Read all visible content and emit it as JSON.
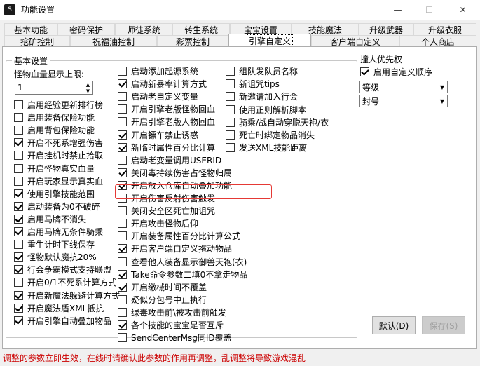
{
  "window": {
    "icon_text": "S",
    "title": "功能设置",
    "minimize": "—",
    "maximize": "☐",
    "close": "✕"
  },
  "tabs_row1": [
    "基本功能",
    "密码保护",
    "师徒系统",
    "转生系统",
    "宝宝设置",
    "技能魔法",
    "升级武器",
    "升级衣服"
  ],
  "tabs_row2": [
    "挖矿控制",
    "祝福油控制",
    "彩票控制",
    "引擎自定义",
    "客户端自定义",
    "个人商店"
  ],
  "active_tab": "引擎自定义",
  "basic_group": {
    "title": "基本设置",
    "hp_label": "怪物血量显示上限:",
    "hp_value": "1"
  },
  "col1": [
    {
      "label": "启用经验更新排行榜",
      "checked": false
    },
    {
      "label": "启用装备保险功能",
      "checked": false
    },
    {
      "label": "启用背包保险功能",
      "checked": false
    },
    {
      "label": "开启不死系增强伤害",
      "checked": true
    },
    {
      "label": "开启挂机时禁止拾取",
      "checked": false
    },
    {
      "label": "开启怪物真实血量",
      "checked": false
    },
    {
      "label": "开启玩家显示真实血",
      "checked": false
    },
    {
      "label": "使用引擎技能范围",
      "checked": true
    },
    {
      "label": "启动装备为0不破碎",
      "checked": true
    },
    {
      "label": "启用马牌不消失",
      "checked": true
    },
    {
      "label": "启用马牌无条件骑乘",
      "checked": true
    },
    {
      "label": "重生计时下线保存",
      "checked": false
    },
    {
      "label": "怪物默认魔抗20%",
      "checked": true
    },
    {
      "label": "行会争霸模式支持联盟",
      "checked": true
    },
    {
      "label": "开启0/1不死系计算方式",
      "checked": false
    },
    {
      "label": "开启新魔法躲避计算方式",
      "checked": true
    },
    {
      "label": "开启魔法盾XML抵抗",
      "checked": true
    },
    {
      "label": "开启引擎自动叠加物品",
      "checked": true
    }
  ],
  "col2": [
    {
      "label": "启动添加起源系统",
      "checked": false
    },
    {
      "label": "启动新暴率计算方式",
      "checked": true
    },
    {
      "label": "启动老自定义变量",
      "checked": false
    },
    {
      "label": "开启引擎老版怪物回血",
      "checked": false
    },
    {
      "label": "开启引擎老版人物回血",
      "checked": false
    },
    {
      "label": "开启镖车禁止诱惑",
      "checked": true
    },
    {
      "label": "新临时属性百分比计算",
      "checked": true
    },
    {
      "label": "启动老变量调用USERID",
      "checked": false
    },
    {
      "label": "关闭毒持续伤害占怪物归属",
      "checked": true
    },
    {
      "label": "开启放入仓库自动叠加功能",
      "checked": true
    },
    {
      "label": "开启伤害反射伤害触发",
      "checked": false
    },
    {
      "label": "关闭安全区死亡加诅咒",
      "checked": false
    },
    {
      "label": "开启攻击怪物后仰",
      "checked": false
    },
    {
      "label": "开启装备属性百分比计算公式",
      "checked": false
    },
    {
      "label": "开启客户端自定义拖动物品",
      "checked": true
    },
    {
      "label": "查看他人装备显示御兽天袍(衣)",
      "checked": false
    },
    {
      "label": "Take命令参数二填0不拿走物品",
      "checked": true
    },
    {
      "label": "开启缴械时间不覆盖",
      "checked": true
    },
    {
      "label": "疑似分包号中止执行",
      "checked": false
    },
    {
      "label": "绿毒攻击前\\被攻击前触发",
      "checked": false
    },
    {
      "label": "各个技能的宝宝是否互斥",
      "checked": true
    },
    {
      "label": "SendCenterMsg同ID覆盖",
      "checked": false
    }
  ],
  "col3": [
    {
      "label": "组队发队员名称",
      "checked": false
    },
    {
      "label": "新诅咒tips",
      "checked": false
    },
    {
      "label": "新邀请加入行会",
      "checked": false
    },
    {
      "label": "使用正则解析脚本",
      "checked": false
    },
    {
      "label": "骑乘/战自动穿脱天袍/衣",
      "checked": false
    },
    {
      "label": "死亡时绑定物品消失",
      "checked": false
    },
    {
      "label": "发送XML技能距离",
      "checked": false
    }
  ],
  "priority_group": {
    "title": "撞人优先权",
    "checkbox_label": "启用自定义顺序",
    "checked": true,
    "select1": "等级",
    "select2": "封号"
  },
  "buttons": {
    "default": "默认(D)",
    "save": "保存(S)"
  },
  "status_text": "调整的参数立即生效，在线时请确认此参数的作用再调整，乱调整将导致游戏混乱"
}
